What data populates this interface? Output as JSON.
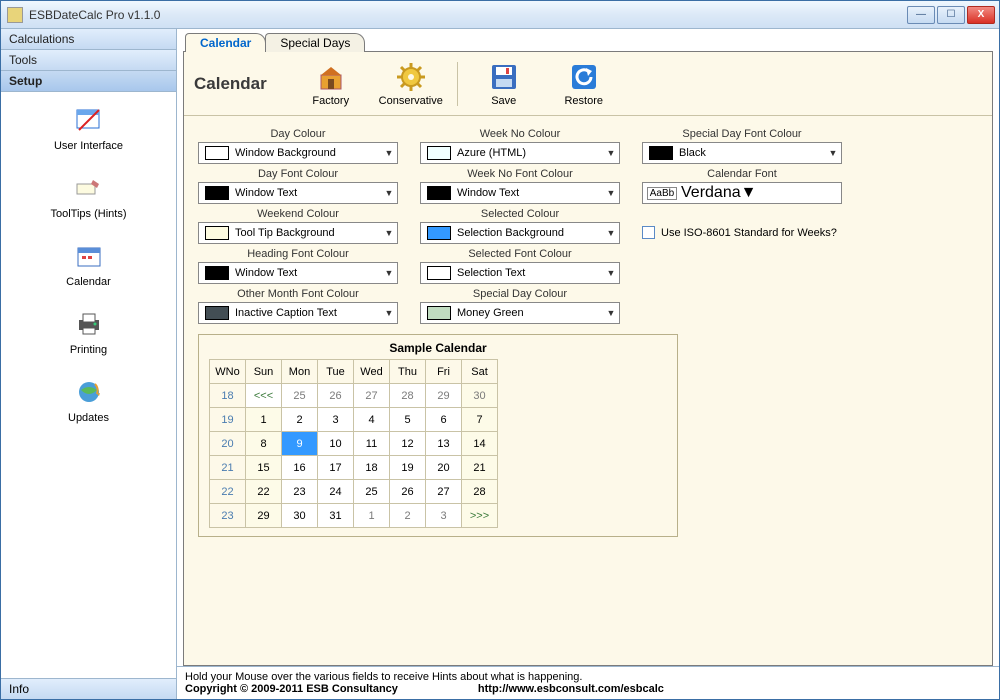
{
  "app": {
    "title": "ESBDateCalc Pro v1.1.0"
  },
  "winbuttons": {
    "min": "—",
    "max": "☐",
    "close": "X"
  },
  "sidebar": {
    "cats": [
      "Calculations",
      "Tools",
      "Setup"
    ],
    "items": [
      {
        "label": "User Interface"
      },
      {
        "label": "ToolTips (Hints)"
      },
      {
        "label": "Calendar"
      },
      {
        "label": "Printing"
      },
      {
        "label": "Updates"
      }
    ],
    "bottom": "Info"
  },
  "tabs": {
    "calendar": "Calendar",
    "special": "Special Days"
  },
  "toolbar": {
    "heading": "Calendar",
    "factory": "Factory",
    "conservative": "Conservative",
    "save": "Save",
    "restore": "Restore"
  },
  "opts": {
    "col1": [
      {
        "label": "Day Colour",
        "color": "#ffffff",
        "name": "Window Background"
      },
      {
        "label": "Day Font Colour",
        "color": "#000000",
        "name": "Window Text"
      },
      {
        "label": "Weekend Colour",
        "color": "#fdfbe0",
        "name": "Tool Tip Background"
      },
      {
        "label": "Heading Font Colour",
        "color": "#000000",
        "name": "Window Text"
      },
      {
        "label": "Other Month Font Colour",
        "color": "#434e54",
        "name": "Inactive Caption Text"
      }
    ],
    "col2": [
      {
        "label": "Week No Colour",
        "color": "#f0ffff",
        "name": "Azure (HTML)"
      },
      {
        "label": "Week No Font Colour",
        "color": "#000000",
        "name": "Window Text"
      },
      {
        "label": "Selected Colour",
        "color": "#3399ff",
        "name": "Selection Background"
      },
      {
        "label": "Selected Font Colour",
        "color": "#ffffff",
        "name": "Selection Text"
      },
      {
        "label": "Special Day Colour",
        "color": "#c0dcc0",
        "name": "Money Green"
      }
    ],
    "col3": {
      "special_day_font": {
        "label": "Special Day Font Colour",
        "color": "#000000",
        "name": "Black"
      },
      "calendar_font": {
        "label": "Calendar Font",
        "preview": "AaBb",
        "name": "Verdana"
      },
      "iso_label": "Use ISO-8601 Standard for Weeks?"
    }
  },
  "sample": {
    "title": "Sample Calendar",
    "head": [
      "WNo",
      "Sun",
      "Mon",
      "Tue",
      "Wed",
      "Thu",
      "Fri",
      "Sat"
    ],
    "rows": [
      {
        "wno": "18",
        "cells": [
          {
            "t": "<<<",
            "nav": true
          },
          {
            "t": "25",
            "o": true
          },
          {
            "t": "26",
            "o": true
          },
          {
            "t": "27",
            "o": true
          },
          {
            "t": "28",
            "o": true
          },
          {
            "t": "29",
            "o": true
          },
          {
            "t": "30",
            "o": true,
            "we": true
          }
        ]
      },
      {
        "wno": "19",
        "cells": [
          {
            "t": "1",
            "we": true
          },
          {
            "t": "2"
          },
          {
            "t": "3"
          },
          {
            "t": "4"
          },
          {
            "t": "5"
          },
          {
            "t": "6"
          },
          {
            "t": "7",
            "we": true
          }
        ]
      },
      {
        "wno": "20",
        "cells": [
          {
            "t": "8",
            "we": true
          },
          {
            "t": "9",
            "sel": true
          },
          {
            "t": "10"
          },
          {
            "t": "11"
          },
          {
            "t": "12"
          },
          {
            "t": "13"
          },
          {
            "t": "14",
            "we": true
          }
        ]
      },
      {
        "wno": "21",
        "cells": [
          {
            "t": "15",
            "we": true
          },
          {
            "t": "16"
          },
          {
            "t": "17"
          },
          {
            "t": "18"
          },
          {
            "t": "19"
          },
          {
            "t": "20"
          },
          {
            "t": "21",
            "we": true
          }
        ]
      },
      {
        "wno": "22",
        "cells": [
          {
            "t": "22",
            "we": true
          },
          {
            "t": "23"
          },
          {
            "t": "24"
          },
          {
            "t": "25"
          },
          {
            "t": "26"
          },
          {
            "t": "27"
          },
          {
            "t": "28",
            "we": true
          }
        ]
      },
      {
        "wno": "23",
        "cells": [
          {
            "t": "29",
            "we": true
          },
          {
            "t": "30"
          },
          {
            "t": "31"
          },
          {
            "t": "1",
            "o": true
          },
          {
            "t": "2",
            "o": true
          },
          {
            "t": "3",
            "o": true
          },
          {
            "t": ">>>",
            "nav": true,
            "we": true
          }
        ]
      }
    ]
  },
  "status": {
    "hint": "Hold your Mouse over the various fields to receive Hints about what is happening.",
    "copyright": "Copyright © 2009-2011 ESB Consultancy",
    "url": "http://www.esbconsult.com/esbcalc"
  }
}
